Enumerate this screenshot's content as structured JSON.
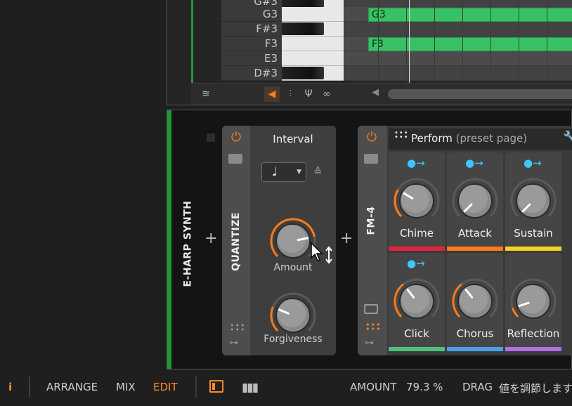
{
  "piano_roll": {
    "rows": [
      {
        "note": "G#3",
        "black": true,
        "clip": ""
      },
      {
        "note": "G3",
        "black": false,
        "clip": "G3"
      },
      {
        "note": "F#3",
        "black": true,
        "clip": ""
      },
      {
        "note": "F3",
        "black": false,
        "clip": "F3"
      },
      {
        "note": "E3",
        "black": false,
        "clip": ""
      },
      {
        "note": "D#3",
        "black": true,
        "clip": ""
      }
    ]
  },
  "track": {
    "name": "E-HARP SYNTH"
  },
  "quantize": {
    "title": "QUANTIZE",
    "param_title": "Interval",
    "interval_value": "♩",
    "knobs": [
      {
        "label": "Amount",
        "value": 0.793
      },
      {
        "label": "Forgiveness",
        "value": 0.25
      }
    ]
  },
  "fm4": {
    "title": "FM-4",
    "preset_page": "Perform",
    "preset_page_sub": "(preset page)",
    "macros": [
      {
        "label": "Chime",
        "value": 0.28,
        "modulated": true,
        "stripe": "#e2243c"
      },
      {
        "label": "Attack",
        "value": 0.0,
        "modulated": true,
        "stripe": "#ff7a1a"
      },
      {
        "label": "Sustain",
        "value": 0.0,
        "modulated": true,
        "stripe": "#f2d61a"
      },
      {
        "label": "Click",
        "value": 0.36,
        "modulated": true,
        "stripe": "#4fc07a"
      },
      {
        "label": "Chorus",
        "value": 0.36,
        "modulated": false,
        "stripe": "#4aa0e8"
      },
      {
        "label": "Reflection",
        "value": 0.1,
        "modulated": false,
        "stripe": "#b070e8"
      }
    ]
  },
  "status": {
    "tabs": [
      "ARRANGE",
      "MIX",
      "EDIT"
    ],
    "active_tab": "EDIT",
    "param_name": "AMOUNT",
    "param_value": "79.3 %",
    "hint_label": "DRAG",
    "hint_text": "値を調節します。"
  },
  "colors": {
    "accent": "#ff7a1a",
    "track": "#1f9a3a",
    "modulation": "#3ec6ff",
    "note_clip": "#38c164"
  }
}
